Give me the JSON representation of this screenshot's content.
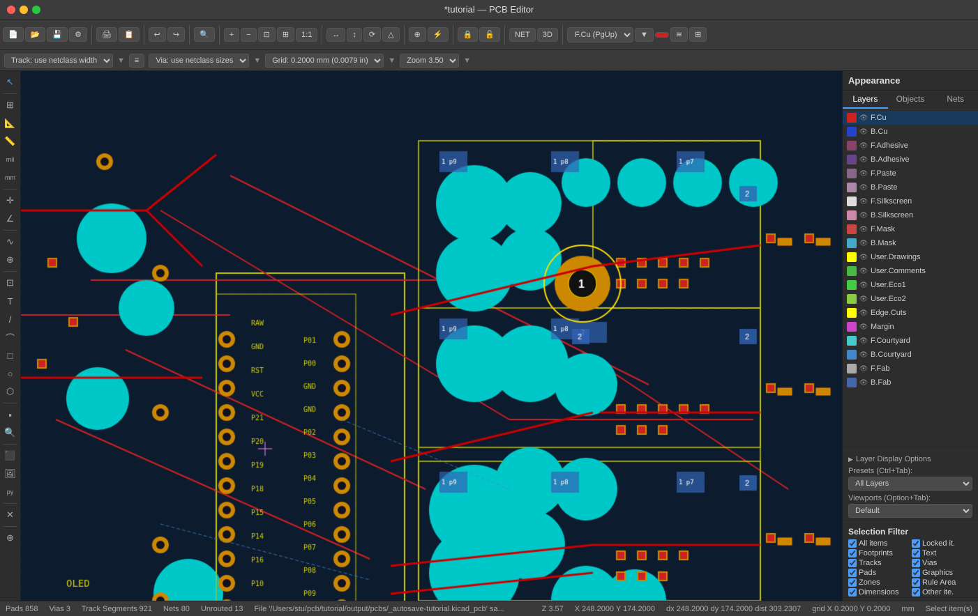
{
  "titlebar": {
    "title": "*tutorial — PCB Editor"
  },
  "toolbar": {
    "track_label": "Track: use netclass width",
    "via_label": "Via: use netclass sizes",
    "grid_label": "Grid: 0.2000 mm (0.0079 in)",
    "zoom_label": "Zoom 3.50",
    "layer_label": "F.Cu (PgUp)"
  },
  "appearance": {
    "title": "Appearance",
    "tabs": [
      "Layers",
      "Objects",
      "Nets"
    ],
    "active_tab": 0,
    "layers": [
      {
        "name": "F.Cu",
        "color": "#cc2222",
        "visible": true,
        "active": true
      },
      {
        "name": "B.Cu",
        "color": "#2244cc",
        "visible": true,
        "active": false
      },
      {
        "name": "F.Adhesive",
        "color": "#884466",
        "visible": true,
        "active": false
      },
      {
        "name": "B.Adhesive",
        "color": "#664488",
        "visible": true,
        "active": false
      },
      {
        "name": "F.Paste",
        "color": "#886688",
        "visible": true,
        "active": false
      },
      {
        "name": "B.Paste",
        "color": "#aa88aa",
        "visible": true,
        "active": false
      },
      {
        "name": "F.Silkscreen",
        "color": "#dddddd",
        "visible": true,
        "active": false
      },
      {
        "name": "B.Silkscreen",
        "color": "#cc88aa",
        "visible": true,
        "active": false
      },
      {
        "name": "F.Mask",
        "color": "#cc4444",
        "visible": true,
        "active": false
      },
      {
        "name": "B.Mask",
        "color": "#44aacc",
        "visible": true,
        "active": false
      },
      {
        "name": "User.Drawings",
        "color": "#ffff00",
        "visible": true,
        "active": false
      },
      {
        "name": "User.Comments",
        "color": "#44bb44",
        "visible": true,
        "active": false
      },
      {
        "name": "User.Eco1",
        "color": "#44cc44",
        "visible": true,
        "active": false
      },
      {
        "name": "User.Eco2",
        "color": "#88cc44",
        "visible": true,
        "active": false
      },
      {
        "name": "Edge.Cuts",
        "color": "#ffff00",
        "visible": true,
        "active": false
      },
      {
        "name": "Margin",
        "color": "#cc44cc",
        "visible": true,
        "active": false
      },
      {
        "name": "F.Courtyard",
        "color": "#44cccc",
        "visible": true,
        "active": false
      },
      {
        "name": "B.Courtyard",
        "color": "#4488cc",
        "visible": true,
        "active": false
      },
      {
        "name": "F.Fab",
        "color": "#aaaaaa",
        "visible": true,
        "active": false
      },
      {
        "name": "B.Fab",
        "color": "#4466aa",
        "visible": true,
        "active": false
      }
    ]
  },
  "layer_display": {
    "section_label": "Layer Display Options",
    "presets_label": "Presets (Ctrl+Tab):",
    "presets_value": "All Layers",
    "viewports_label": "Viewports (Option+Tab):"
  },
  "selection_filter": {
    "title": "Selection Filter",
    "items": [
      {
        "label": "All items",
        "checked": true
      },
      {
        "label": "Locked it.",
        "checked": true
      },
      {
        "label": "Footprints",
        "checked": true
      },
      {
        "label": "Text",
        "checked": true
      },
      {
        "label": "Tracks",
        "checked": true
      },
      {
        "label": "Vias",
        "checked": true
      },
      {
        "label": "Pads",
        "checked": true
      },
      {
        "label": "Graphics",
        "checked": true
      },
      {
        "label": "Zones",
        "checked": true
      },
      {
        "label": "Rule Area",
        "checked": true
      },
      {
        "label": "Dimensions",
        "checked": true
      },
      {
        "label": "Other ite.",
        "checked": true
      }
    ]
  },
  "statusbar": {
    "pads_label": "Pads",
    "pads_value": "858",
    "vias_label": "Vias",
    "vias_value": "3",
    "segments_label": "Track Segments",
    "segments_value": "921",
    "nets_label": "Nets",
    "nets_value": "80",
    "unrouted_label": "Unrouted",
    "unrouted_value": "13",
    "file_path": "File '/Users/stu/pcb/tutorial/output/pcbs/_autosave-tutorial.kicad_pcb' sa...",
    "zoom": "Z 3.57",
    "coords": "X 248.2000  Y 174.2000",
    "delta": "dx 248.2000  dy 174.2000  dist 303.2307",
    "grid": "grid X 0.2000  Y 0.2000",
    "unit": "mm",
    "status": "Select item(s)"
  }
}
